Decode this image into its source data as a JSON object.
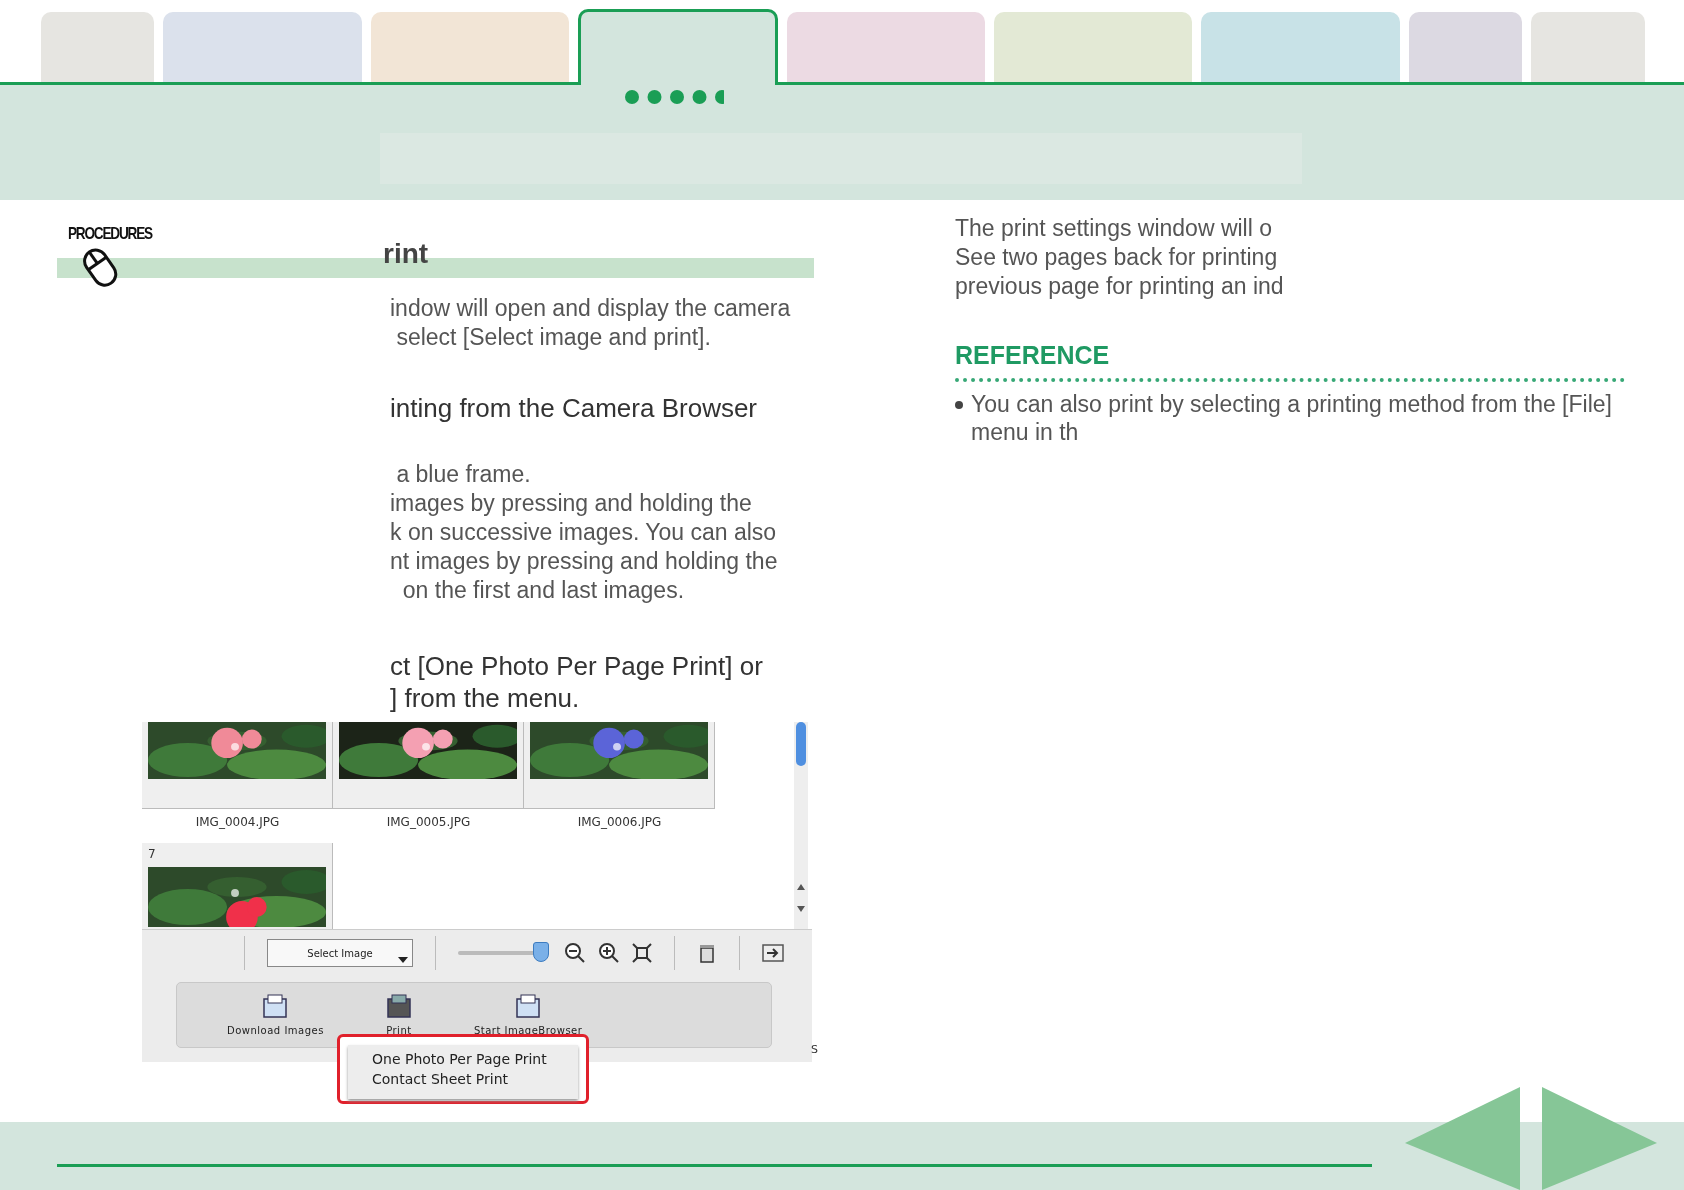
{
  "tabs": [
    {
      "color": "#e6e5e1",
      "selected": false
    },
    {
      "color": "#dbe1ec",
      "selected": false
    },
    {
      "color": "#f2e5d6",
      "selected": false
    },
    {
      "color": "#d3e5dd",
      "selected": true
    },
    {
      "color": "#ecdae3",
      "selected": false
    },
    {
      "color": "#e3e9d5",
      "selected": false
    },
    {
      "color": "#c8e2e7",
      "selected": false
    },
    {
      "color": "#dcd9e2",
      "selected": false
    },
    {
      "color": "#e6e5e1",
      "selected": false
    }
  ],
  "section_label": "PROCEDURES",
  "title": "rint",
  "steps": [
    {
      "kind": "body",
      "lines": [
        "indow will open and display the camera",
        " select [Select image and print]."
      ]
    },
    {
      "kind": "heading",
      "lines": [
        "inting from the Camera Browser"
      ]
    },
    {
      "kind": "body",
      "lines": [
        " a blue frame.",
        "images by pressing and holding the",
        "k on successive images. You can also",
        "nt images by pressing and holding the",
        "  on the first and last images."
      ]
    },
    {
      "kind": "step",
      "lines": [
        "ct [One Photo Per Page Print] or",
        "] from the menu."
      ]
    }
  ],
  "screenshot": {
    "thumbnails": [
      {
        "label": "IMG_0004.JPG"
      },
      {
        "label": "IMG_0005.JPG"
      },
      {
        "label": "IMG_0006.JPG"
      }
    ],
    "next_row_label": "7",
    "select": "Select Image",
    "zoom_slider": {
      "level": 0.92
    },
    "buttons": [
      {
        "label": "Download Images"
      },
      {
        "label": "Print"
      },
      {
        "label": "Start ImageBrowser"
      }
    ],
    "edge_text": "S",
    "menu": [
      {
        "label": "One Photo Per Page Print"
      },
      {
        "label": "Contact Sheet Print"
      }
    ]
  },
  "right_lines": [
    "The print settings window will o",
    "See two pages back for printing",
    "previous page for printing an ind"
  ],
  "reference": {
    "title": "REFERENCE",
    "bullets": [
      "You can also print by selecting a printing method from the [File] menu in th"
    ]
  }
}
